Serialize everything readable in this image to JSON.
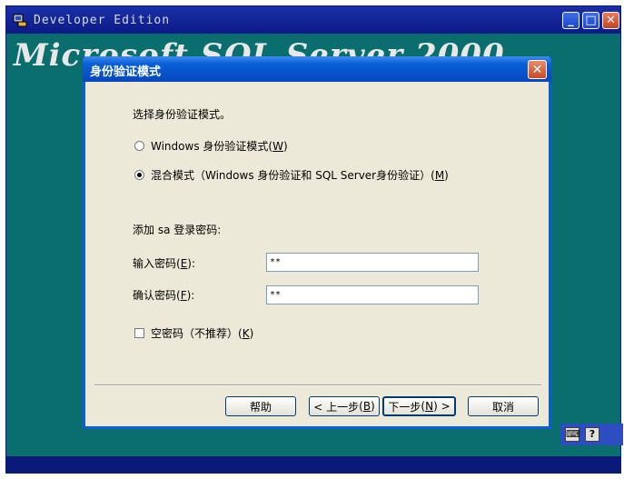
{
  "outer_window": {
    "title": "Developer Edition",
    "banner": "Microsoft SQL Server 2000",
    "minimize": "_",
    "maximize": "□",
    "close": "✕"
  },
  "dialog": {
    "title": "身份验证模式",
    "close": "✕",
    "prompt": "选择身份验证模式。",
    "radio_windows": {
      "text": "Windows 身份验证模式",
      "key": "W",
      "checked": false
    },
    "radio_mixed": {
      "text": "混合模式（Windows 身份验证和 SQL Server身份验证）",
      "key": "M",
      "checked": true
    },
    "sa_label": "添加 sa 登录密码:",
    "password_label": "输入密码",
    "password_key": "E",
    "password_value": "**",
    "confirm_label": "确认密码",
    "confirm_key": "F",
    "confirm_value": "**",
    "blank_password": {
      "text": "空密码（不推荐）",
      "key": "K",
      "checked": false
    },
    "buttons": {
      "help": "帮助",
      "back_prefix": "< 上一步",
      "back_key": "B",
      "next_prefix": "下一步",
      "next_key": "N",
      "next_suffix": ">",
      "cancel": "取消"
    }
  },
  "taskbar": {
    "icon1": "keyboard-icon",
    "icon2": "help-icon",
    "icon2_glyph": "?"
  }
}
